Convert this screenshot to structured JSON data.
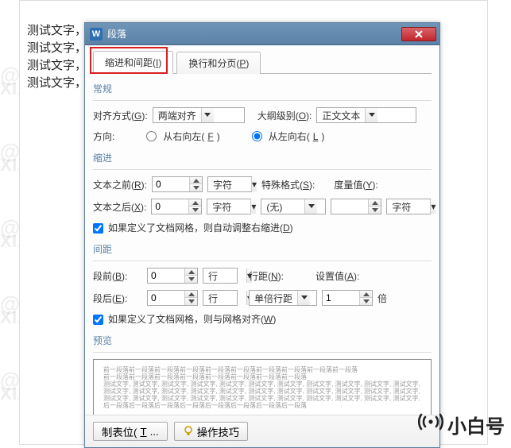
{
  "watermark": {
    "cn": "@小白号",
    "en": "XIAOBAIHAO.COM",
    "badge_cn": "小白号"
  },
  "doc": {
    "lines": [
      "测试文字，测试文字，测试文字，测试文字，测试文字，测试文字，",
      "测试文字，测试文字，测试文字，测试文字，测试文字，测试文字，",
      "测试文字，测试文字，测试文字，测试文字，测试文字，测试文字，",
      "测试文字，测试文字，测试文字，测试文字，测试文字，测试文字。"
    ]
  },
  "dialog": {
    "appicon": "W",
    "title": "段落",
    "tabs": {
      "indent": {
        "label_pre": "缩进和间距(",
        "hot": "I",
        "label_post": ")"
      },
      "page": {
        "label_pre": "换行和分页(",
        "hot": "P",
        "label_post": ")"
      }
    },
    "section_general": "常规",
    "align": {
      "label_pre": "对齐方式(",
      "hot": "G",
      "label_post": "):",
      "value": "两端对齐"
    },
    "outline": {
      "label_pre": "大纲级别(",
      "hot": "O",
      "label_post": "):",
      "value": "正文文本"
    },
    "direction": {
      "label": "方向:",
      "rtl": {
        "pre": "从右向左(",
        "hot": "F",
        "post": ")"
      },
      "ltr": {
        "pre": "从左向右(",
        "hot": "L",
        "post": ")"
      }
    },
    "section_indent": "缩进",
    "indent_before": {
      "pre": "文本之前(",
      "hot": "R",
      "post": "):",
      "value": "0",
      "unit_pre": "字符",
      "unit_arrow": "▾"
    },
    "special": {
      "pre": "特殊格式(",
      "hot": "S",
      "post": "):",
      "value": "(无)"
    },
    "measure": {
      "pre": "度量值(",
      "hot": "Y",
      "post": "):",
      "value": "",
      "unit": "字符"
    },
    "indent_after": {
      "pre": "文本之后(",
      "hot": "X",
      "post": "):",
      "value": "0",
      "unit": "字符"
    },
    "indent_check": {
      "pre": "如果定义了文档网格，则自动调整右缩进(",
      "hot": "D",
      "post": ")"
    },
    "section_spacing": "间距",
    "space_before": {
      "pre": "段前(",
      "hot": "B",
      "post": "):",
      "value": "0",
      "unit_pre": "行",
      "unit_arrow": "▾"
    },
    "line_spacing": {
      "pre": "行距(",
      "hot": "N",
      "post": "):",
      "value": "单倍行距"
    },
    "set_value": {
      "pre": "设置值(",
      "hot": "A",
      "post": "):",
      "value": "1",
      "unit": "倍"
    },
    "space_after": {
      "pre": "段后(",
      "hot": "E",
      "post": "):",
      "value": "0",
      "unit_pre": "行",
      "unit_arrow": "▾"
    },
    "spacing_check": {
      "pre": "如果定义了文档网格，则与网格对齐(",
      "hot": "W",
      "post": ")"
    },
    "section_preview": "预览",
    "preview_sample": "测试文字,",
    "footer": {
      "tabstops": {
        "pre": "制表位(",
        "hot": "T",
        "post": "..."
      },
      "tips": "操作技巧"
    }
  }
}
